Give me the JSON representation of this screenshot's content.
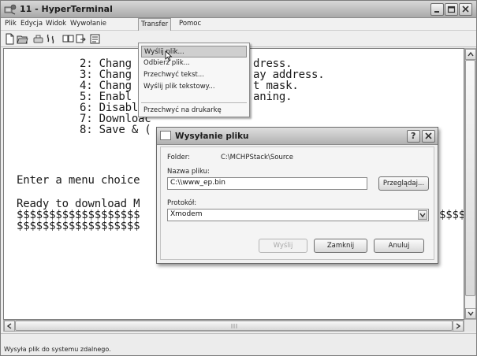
{
  "window": {
    "title": "11 - HyperTerminal"
  },
  "menubar": {
    "items": [
      "Plik",
      "Edycja",
      "Widok",
      "Wywołanie",
      "Transfer",
      "Pomoc"
    ]
  },
  "terminal": {
    "lines": [
      "2: Chang",
      "3: Chang",
      "4: Chang",
      "5: Enabl",
      "6: Disable",
      "7: Downloac",
      "8: Save & (",
      "",
      "Enter a menu choice",
      "",
      "Ready to download M",
      "$$$$$$$$$$$$$$$$$$$",
      "$$$$$$$$$$$$$$$$$$$"
    ],
    "right_fragments": [
      {
        "text": "dress.",
        "line": 0
      },
      {
        "text": "ay address.",
        "line": 1
      },
      {
        "text": "t mask.",
        "line": 2
      },
      {
        "text": "aning.",
        "line": 3
      },
      {
        "text": "$$$$",
        "line": 11
      }
    ]
  },
  "transfer_menu": {
    "items": [
      {
        "label": "Wyślij plik...",
        "highlighted": true
      },
      {
        "label": "Odbierz plik..."
      },
      {
        "label": "Przechwyć tekst..."
      },
      {
        "label": "Wyślij plik tekstowy..."
      },
      {
        "label": "Przechwyć na drukarkę"
      }
    ]
  },
  "dialog": {
    "title": "Wysyłanie pliku",
    "folder_label": "Folder:",
    "folder_value": "C:\\MCHPStack\\Source",
    "filename_label": "Nazwa pliku:",
    "filename_value": "C:\\\\www_ep.bin",
    "browse_label": "Przeglądaj...",
    "protocol_label": "Protokół:",
    "protocol_value": "Xmodem",
    "send_label": "Wyślij",
    "close_label": "Zamknij",
    "cancel_label": "Anuluj",
    "help_label": "?"
  },
  "statusbar": {
    "text": "Wysyła plik do systemu zdalnego."
  },
  "colors": {
    "highlight": "#cfcfcf",
    "disabled_text": "#a8a8a8"
  }
}
